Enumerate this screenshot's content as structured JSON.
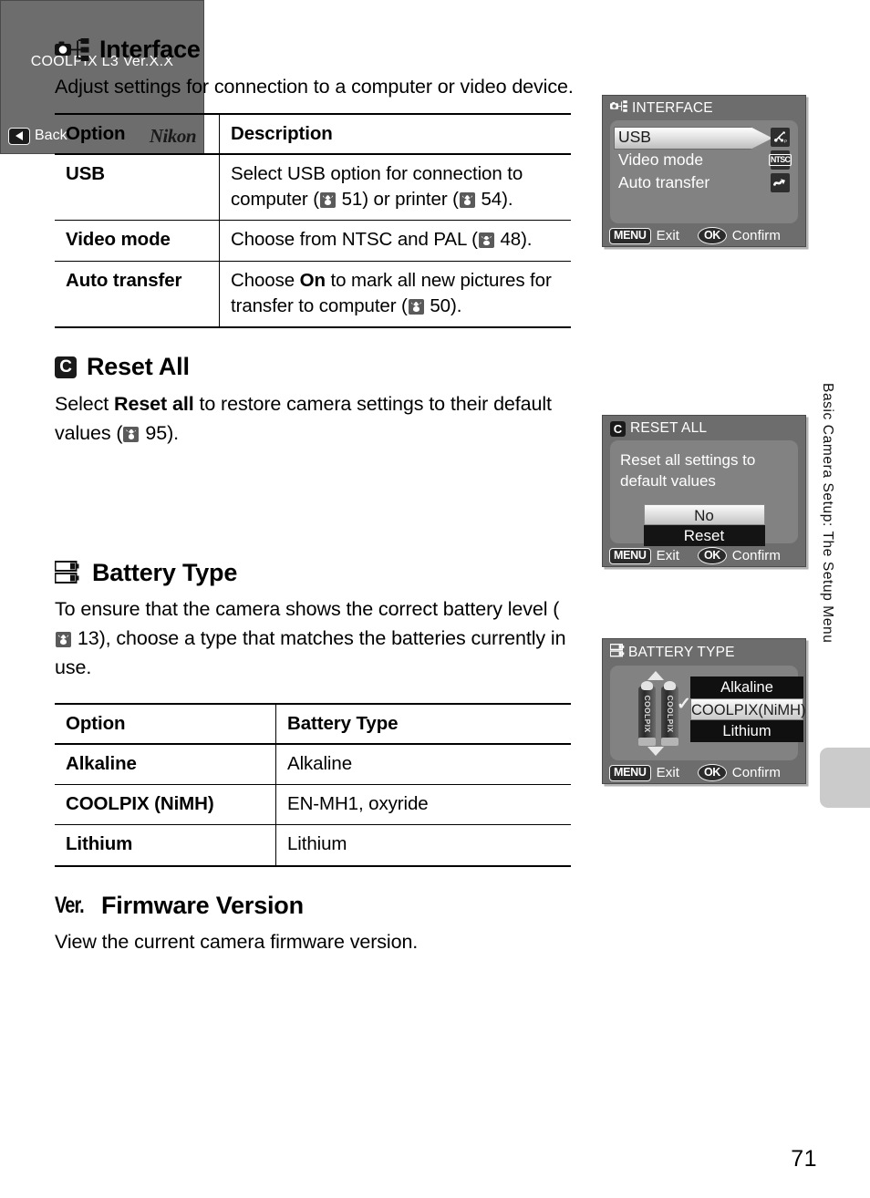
{
  "page": {
    "number": "71",
    "side_tab_text": "Basic Camera Setup: The Setup Menu"
  },
  "sections": {
    "interface": {
      "heading": "Interface",
      "icon": "camera-network-icon",
      "intro": "Adjust settings for connection to a computer or video device.",
      "table": {
        "headers": [
          "Option",
          "Description"
        ],
        "rows": [
          {
            "option": "USB",
            "desc_pre": "Select USB option for connection to computer (",
            "ref1": "51",
            "desc_mid": ") or printer (",
            "ref2": "54",
            "desc_post": ")."
          },
          {
            "option": "Video mode",
            "desc_pre": "Choose from NTSC and PAL (",
            "ref1": "48",
            "desc_post": ")."
          },
          {
            "option": "Auto transfer",
            "desc_pre": "Choose ",
            "bold": "On",
            "desc_mid2": " to mark all new pictures for transfer to computer (",
            "ref1": "50",
            "desc_post": ")."
          }
        ]
      }
    },
    "reset_all": {
      "heading": "Reset All",
      "icon_letter": "C",
      "text_pre": "Select ",
      "text_bold": "Reset all",
      "text_mid": " to restore camera settings to their default values (",
      "ref": "95",
      "text_post": ")."
    },
    "battery_type": {
      "heading": "Battery Type",
      "icon": "battery-stack-icon",
      "text_pre": "To ensure that the camera shows the correct battery level (",
      "ref": "13",
      "text_post": "), choose a type that matches the batteries currently in use.",
      "table": {
        "headers": [
          "Option",
          "Battery Type"
        ],
        "rows": [
          {
            "option": "Alkaline",
            "type": "Alkaline"
          },
          {
            "option": "COOLPIX (NiMH)",
            "type": "EN-MH1, oxyride"
          },
          {
            "option": "Lithium",
            "type": "Lithium"
          }
        ]
      }
    },
    "firmware_version": {
      "heading": "Firmware Version",
      "icon_text": "Ver.",
      "text": "View the current camera firmware version."
    }
  },
  "screens": {
    "interface": {
      "title": "INTERFACE",
      "rows": [
        {
          "label": "USB",
          "icon": "usb-icon",
          "selected": true
        },
        {
          "label": "Video mode",
          "icon": "NTSC",
          "selected": false
        },
        {
          "label": "Auto transfer",
          "icon": "transfer-wave-icon",
          "selected": false
        }
      ],
      "footer": {
        "menu_key": "MENU",
        "menu_label": "Exit",
        "ok_key": "OK",
        "ok_label": "Confirm"
      }
    },
    "reset_all": {
      "title": "RESET ALL",
      "message": "Reset all settings to default values",
      "buttons": [
        {
          "label": "No",
          "selected": true
        },
        {
          "label": "Reset",
          "selected": false
        }
      ],
      "footer": {
        "menu_key": "MENU",
        "menu_label": "Exit",
        "ok_key": "OK",
        "ok_label": "Confirm"
      }
    },
    "battery_type": {
      "title": "BATTERY TYPE",
      "battery_label": "COOLPIX",
      "options": [
        {
          "label": "Alkaline",
          "selected": false
        },
        {
          "label": "COOLPIX(NiMH)",
          "selected": true
        },
        {
          "label": "Lithium",
          "selected": false
        }
      ],
      "footer": {
        "menu_key": "MENU",
        "menu_label": "Exit",
        "ok_key": "OK",
        "ok_label": "Confirm"
      }
    },
    "firmware": {
      "version_text": "COOLPIX L3 Ver.X.X",
      "back_label": "Back",
      "brand": "Nikon"
    }
  }
}
